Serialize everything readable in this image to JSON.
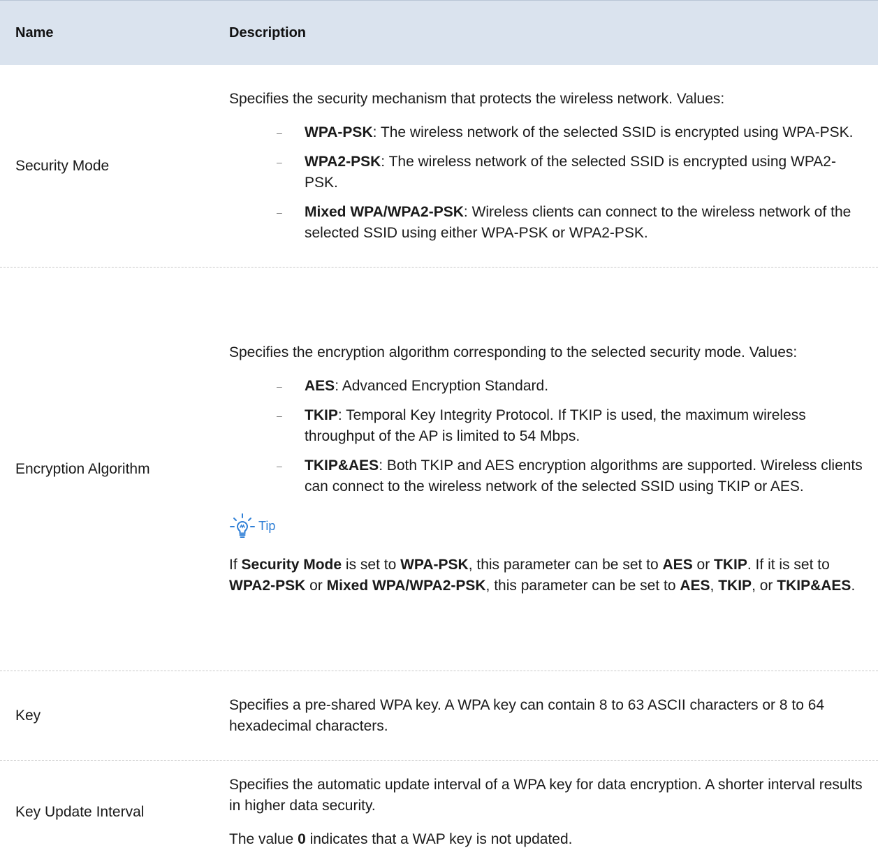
{
  "header": {
    "name": "Name",
    "description": "Description"
  },
  "rows": {
    "security_mode": {
      "name": "Security Mode",
      "intro": "Specifies the security mechanism that protects the wireless network. Values:",
      "items": [
        {
          "term": "WPA-PSK",
          "text": ": The wireless network of the selected SSID is encrypted using WPA-PSK."
        },
        {
          "term": "WPA2-PSK",
          "text": ": The wireless network of the selected SSID is encrypted using WPA2-PSK."
        },
        {
          "term": "Mixed WPA/WPA2-PSK",
          "text": ": Wireless clients can connect to the wireless network of the selected SSID using either WPA-PSK or WPA2-PSK."
        }
      ]
    },
    "encryption_algorithm": {
      "name": "Encryption Algorithm",
      "intro": "Specifies the encryption algorithm corresponding to the selected security mode. Values:",
      "items": [
        {
          "term": "AES",
          "text": ": Advanced Encryption Standard."
        },
        {
          "term": "TKIP",
          "text": ": Temporal Key Integrity Protocol. If TKIP is used, the maximum wireless throughput of the AP is limited to 54 Mbps."
        },
        {
          "term": "TKIP&AES",
          "text": ": Both TKIP and AES encryption algorithms are supported. Wireless clients can connect to the wireless network of the selected SSID using TKIP or AES."
        }
      ],
      "tip_label": "Tip",
      "tip": {
        "t1": "If ",
        "b1": "Security Mode",
        "t2": " is set to ",
        "b2": "WPA-PSK",
        "t3": ", this parameter can be set to ",
        "b3": "AES",
        "t4": " or ",
        "b4": "TKIP",
        "t5": ". If it is set to ",
        "b5": "WPA2-PSK",
        "t6": " or ",
        "b6": "Mixed WPA/WPA2-PSK",
        "t7": ", this parameter can be set to ",
        "b7": "AES",
        "t8": ", ",
        "b8": "TKIP",
        "t9": ", or ",
        "b9": "TKIP&AES",
        "t10": "."
      }
    },
    "key": {
      "name": "Key",
      "desc": "Specifies a pre-shared WPA key. A WPA key can contain 8 to 63 ASCII characters or 8 to 64 hexadecimal characters."
    },
    "key_update_interval": {
      "name": "Key Update Interval",
      "desc": "Specifies the automatic update interval of a WPA key for data encryption. A shorter interval results in higher data security.",
      "note_pre": "The value ",
      "note_bold": "0",
      "note_post": " indicates that a WAP key is not updated."
    }
  },
  "colors": {
    "header_bg": "#dae3ee",
    "tip": "#2f7fd6"
  },
  "icons": {
    "tip": "lightbulb-icon",
    "bullet": "dash"
  }
}
